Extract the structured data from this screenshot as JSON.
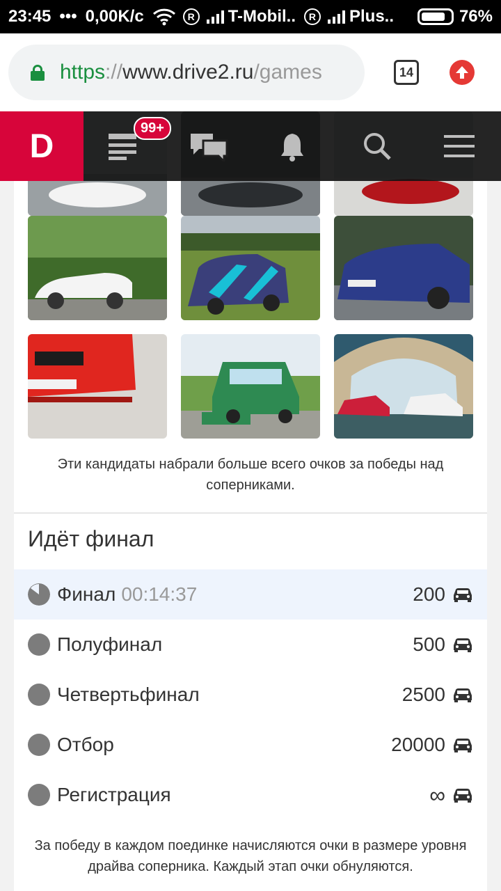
{
  "status_bar": {
    "time": "23:45",
    "dots": "•••",
    "speed": "0,00K/c",
    "carrier1": "T-Mobil..",
    "carrier2": "Plus..",
    "battery": "76%"
  },
  "browser": {
    "url_scheme": "https",
    "url_sep": "://",
    "url_host": "www.drive2.ru",
    "url_path": "/games",
    "tab_count": "14"
  },
  "site_nav": {
    "logo": "D",
    "notifications_badge": "99+"
  },
  "candidates_caption": "Эти кандидаты набрали больше всего очков за победы над соперниками.",
  "final_section": {
    "title": "Идёт финал",
    "stages": [
      {
        "label": "Финал",
        "timer": "00:14:37",
        "value": "200"
      },
      {
        "label": "Полуфинал",
        "value": "500"
      },
      {
        "label": "Четвертьфинал",
        "value": "2500"
      },
      {
        "label": "Отбор",
        "value": "20000"
      },
      {
        "label": "Регистрация",
        "value": "∞"
      }
    ],
    "footer": "За победу в каждом поединке начисляются очки в размере уровня драйва соперника. Каждый этап очки обнуляются."
  },
  "colors": {
    "brand": "#d7053a",
    "url_green": "#1a8f3f",
    "active_row": "#eef4fd"
  }
}
